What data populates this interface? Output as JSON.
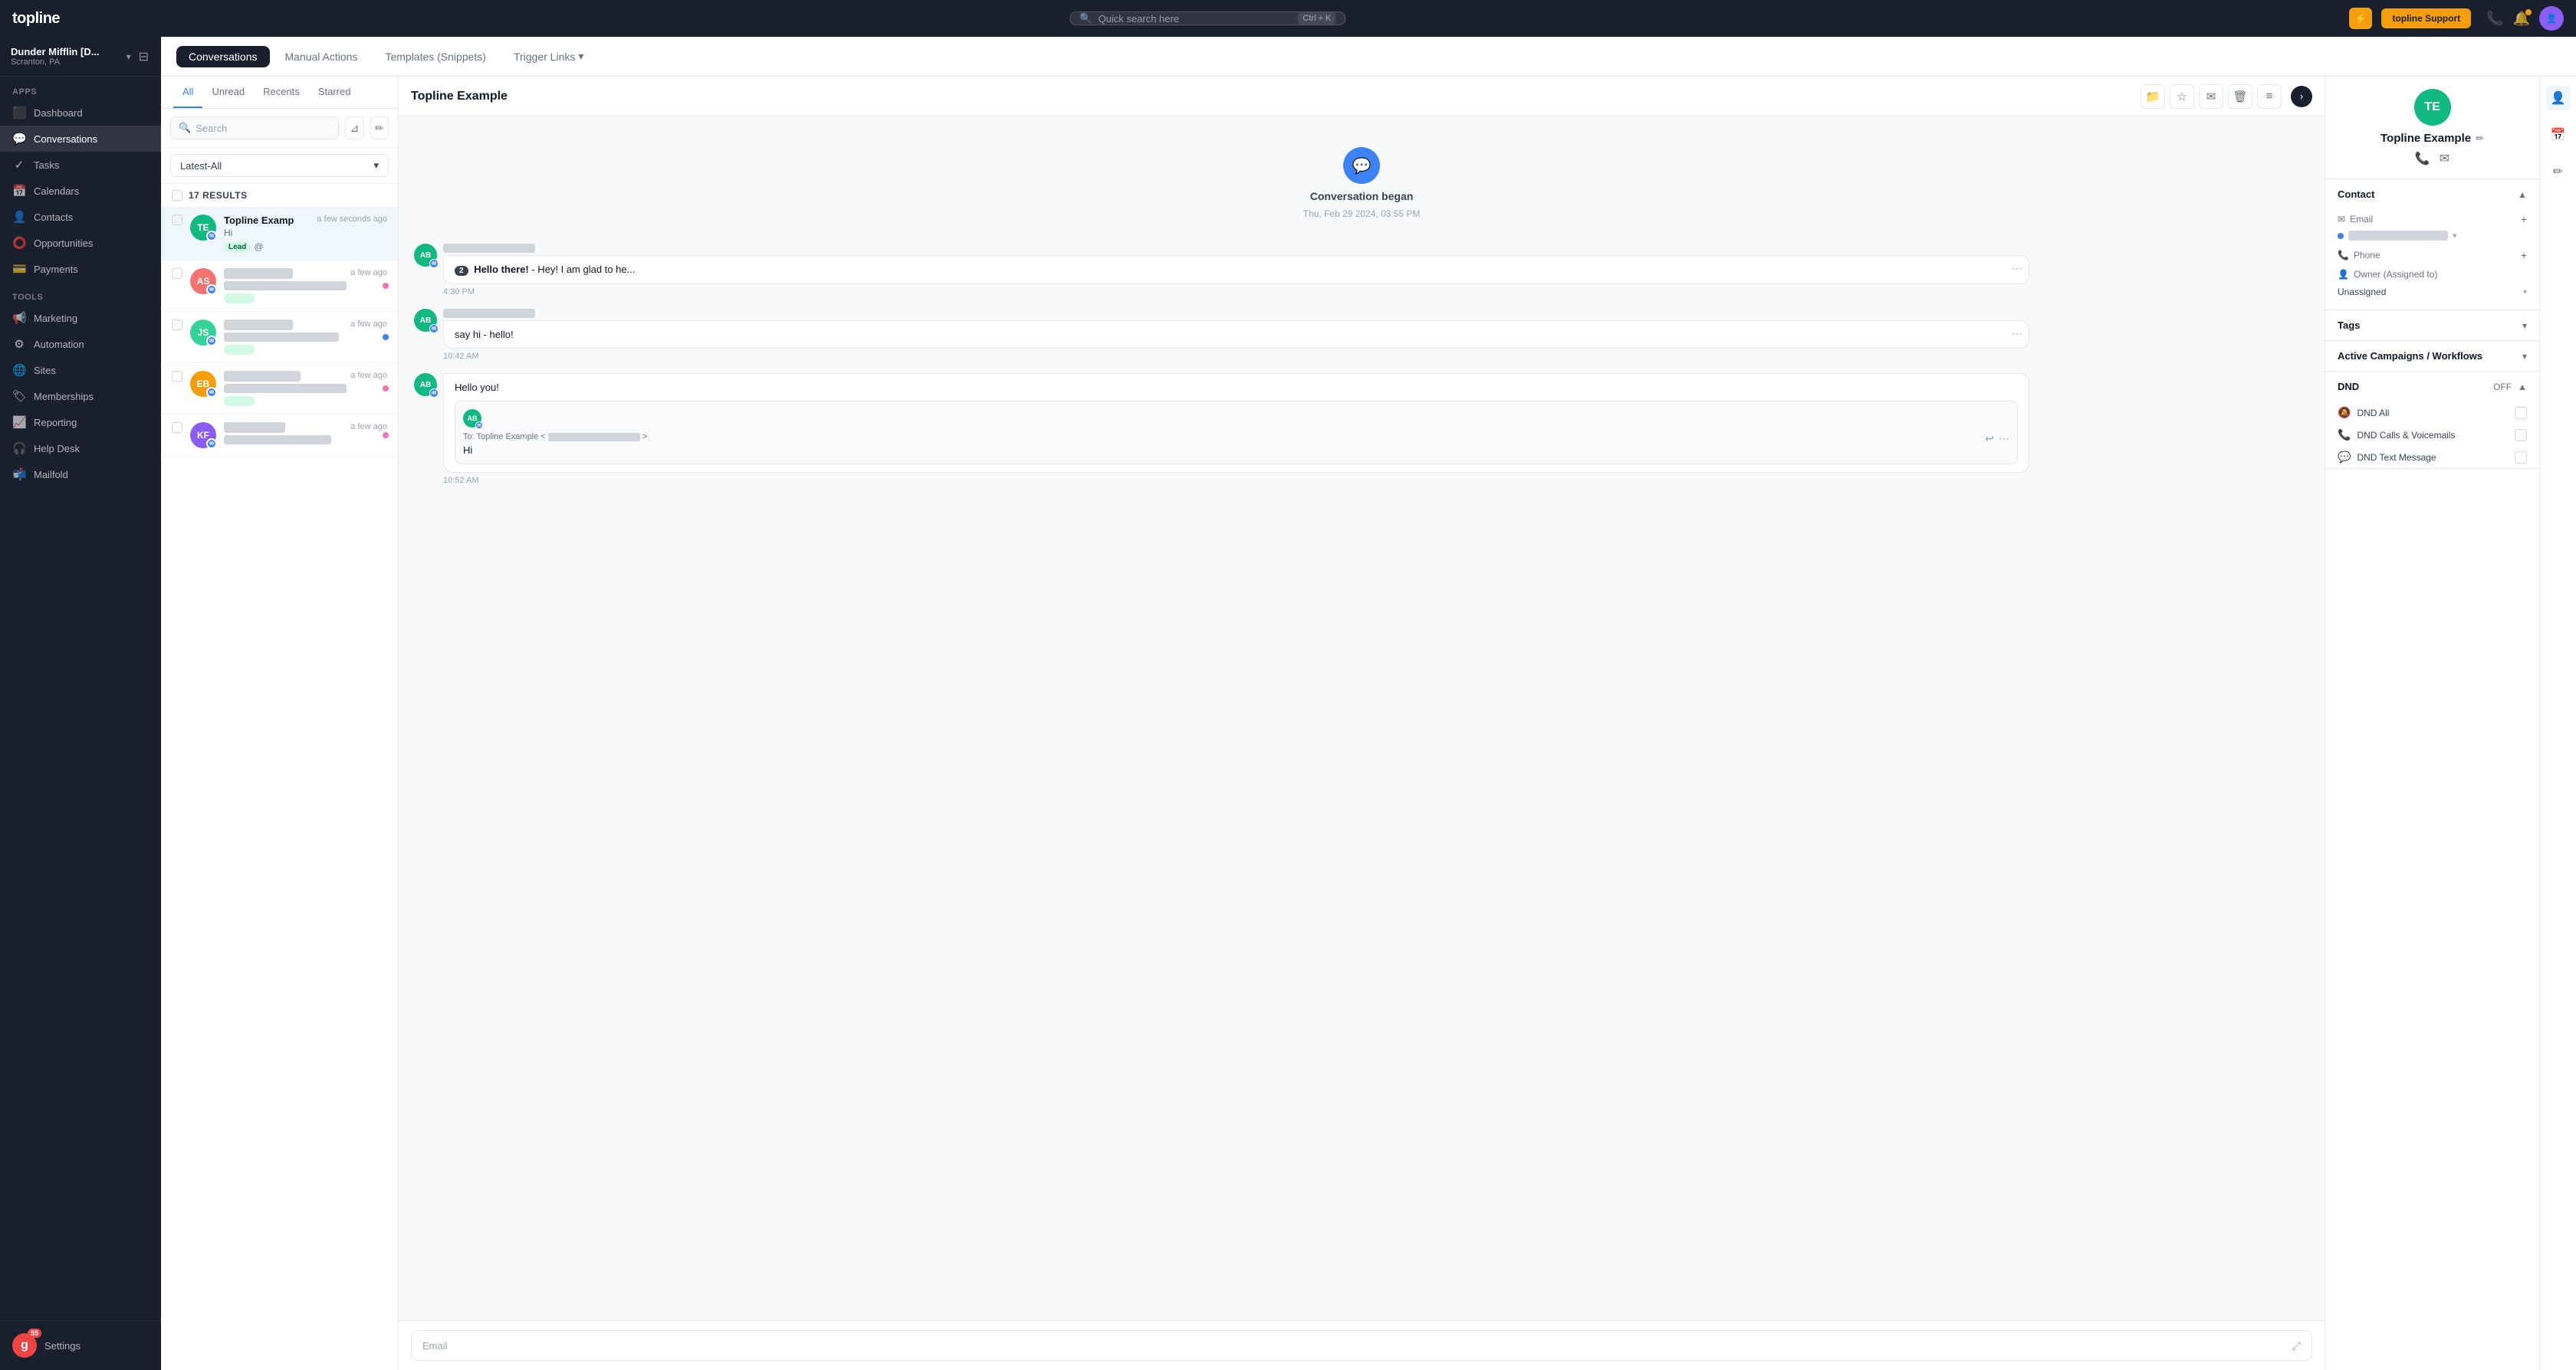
{
  "app": {
    "logo": "topline",
    "search_placeholder": "Quick search here",
    "search_shortcut": "Ctrl + K",
    "support_btn": "topline Support",
    "lightning_icon": "⚡"
  },
  "workspace": {
    "name": "Dunder Mifflin [D...",
    "location": "Scranton, PA"
  },
  "sidebar": {
    "apps_label": "Apps",
    "tools_label": "Tools",
    "items": [
      {
        "id": "dashboard",
        "label": "Dashboard",
        "icon": "📊"
      },
      {
        "id": "conversations",
        "label": "Conversations",
        "icon": "💬",
        "active": true
      },
      {
        "id": "tasks",
        "label": "Tasks",
        "icon": "✓"
      },
      {
        "id": "calendars",
        "label": "Calendars",
        "icon": "📅"
      },
      {
        "id": "contacts",
        "label": "Contacts",
        "icon": "👤"
      },
      {
        "id": "opportunities",
        "label": "Opportunities",
        "icon": "⭕"
      },
      {
        "id": "payments",
        "label": "Payments",
        "icon": "💳"
      }
    ],
    "tools": [
      {
        "id": "marketing",
        "label": "Marketing",
        "icon": "📢"
      },
      {
        "id": "automation",
        "label": "Automation",
        "icon": "⚙"
      },
      {
        "id": "sites",
        "label": "Sites",
        "icon": "🌐"
      },
      {
        "id": "memberships",
        "label": "Memberships",
        "icon": "🏷"
      },
      {
        "id": "reporting",
        "label": "Reporting",
        "icon": "📈"
      },
      {
        "id": "helpdesk",
        "label": "Help Desk",
        "icon": "🎧"
      },
      {
        "id": "mailfold",
        "label": "Mailfold",
        "icon": "📬"
      }
    ],
    "settings": {
      "label": "Settings",
      "icon": "⚙",
      "badge": "55"
    }
  },
  "sub_header": {
    "tabs": [
      {
        "id": "conversations",
        "label": "Conversations",
        "active": true
      },
      {
        "id": "manual-actions",
        "label": "Manual Actions"
      },
      {
        "id": "templates",
        "label": "Templates (Snippets)"
      },
      {
        "id": "trigger-links",
        "label": "Trigger Links",
        "has_chevron": true
      }
    ]
  },
  "conversation_list": {
    "tabs": [
      {
        "id": "all",
        "label": "All",
        "active": true
      },
      {
        "id": "unread",
        "label": "Unread"
      },
      {
        "id": "recents",
        "label": "Recents"
      },
      {
        "id": "starred",
        "label": "Starred"
      }
    ],
    "search_placeholder": "Search",
    "filter_label": "Latest-All",
    "results_count": "17 RESULTS",
    "items": [
      {
        "id": "topline",
        "initials": "TE",
        "bg": "#10b981",
        "name": "Topline Examp",
        "time": "a few seconds ago",
        "preview": "Hi",
        "tag": "Lead",
        "tag_color": "green",
        "active": true,
        "has_at": true
      },
      {
        "id": "conv2",
        "initials": "AS",
        "bg": "#f87171",
        "name": "████ ██████",
        "time": "a few ago",
        "preview": "████████████████",
        "tag": "████",
        "tag_color": "green",
        "dot": "pink"
      },
      {
        "id": "conv3",
        "initials": "JS",
        "bg": "#34d399",
        "name": "████ ██████",
        "time": "a few ago",
        "preview": "██ ██████████ ████",
        "tag": "████",
        "tag_color": "green",
        "dot": "blue"
      },
      {
        "id": "conv4",
        "initials": "EB",
        "bg": "#f59e0b",
        "name": "███████ ██████",
        "time": "a few ago",
        "preview": "███████████ ████",
        "tag": "████",
        "tag_color": "green",
        "dot": "pink"
      },
      {
        "id": "conv5",
        "initials": "KF",
        "bg": "#8b5cf6",
        "name": "████ ████",
        "time": "a few ago",
        "preview": "████████████",
        "tag": "",
        "dot": "pink"
      }
    ]
  },
  "conversation_detail": {
    "name": "Topline Example",
    "started_text": "Conversation began",
    "started_date": "Thu, Feb 29 2024, 03:55 PM",
    "messages": [
      {
        "id": "msg1",
        "sender_initials": "AB",
        "sender_bg": "#10b981",
        "sender_name": "████████████",
        "count_badge": "2",
        "text_preview": "Hello there!",
        "text_suffix": "- Hey! I am glad to he...",
        "time": "4:30 PM",
        "has_more": true
      },
      {
        "id": "msg2",
        "sender_initials": "AB",
        "sender_bg": "#10b981",
        "sender_name": "████████████",
        "text": "say hi",
        "text_suffix": "- hello!",
        "time": "10:42 AM",
        "has_more": true
      },
      {
        "id": "msg3",
        "type": "hello",
        "sender_initials": "AB",
        "sender_bg": "#10b981",
        "text": "Hello you!",
        "time": ""
      },
      {
        "id": "msg4",
        "type": "email",
        "sender_initials": "AB",
        "sender_bg": "#10b981",
        "to_name": "Topline Example",
        "to_email": "████████████████",
        "body": "Hi",
        "time": "10:52 AM"
      }
    ],
    "input_label": "Email"
  },
  "right_panel": {
    "contact_initials": "TE",
    "contact_bg": "#10b981",
    "contact_name": "Topline Example",
    "sections": {
      "contact": {
        "title": "Contact",
        "email_label": "Email",
        "email_value": "████████████████",
        "phone_label": "Phone",
        "owner_label": "Owner (Assigned to)",
        "owner_value": "Unassigned"
      },
      "tags": {
        "title": "Tags"
      },
      "campaigns": {
        "title": "Active Campaigns / Workflows"
      },
      "dnd": {
        "title": "DND",
        "status": "OFF",
        "items": [
          {
            "label": "DND All",
            "icon": "🔕"
          },
          {
            "label": "DND Calls & Voicemails",
            "icon": "📞"
          },
          {
            "label": "DND Text Message",
            "icon": "💬"
          }
        ]
      }
    }
  }
}
